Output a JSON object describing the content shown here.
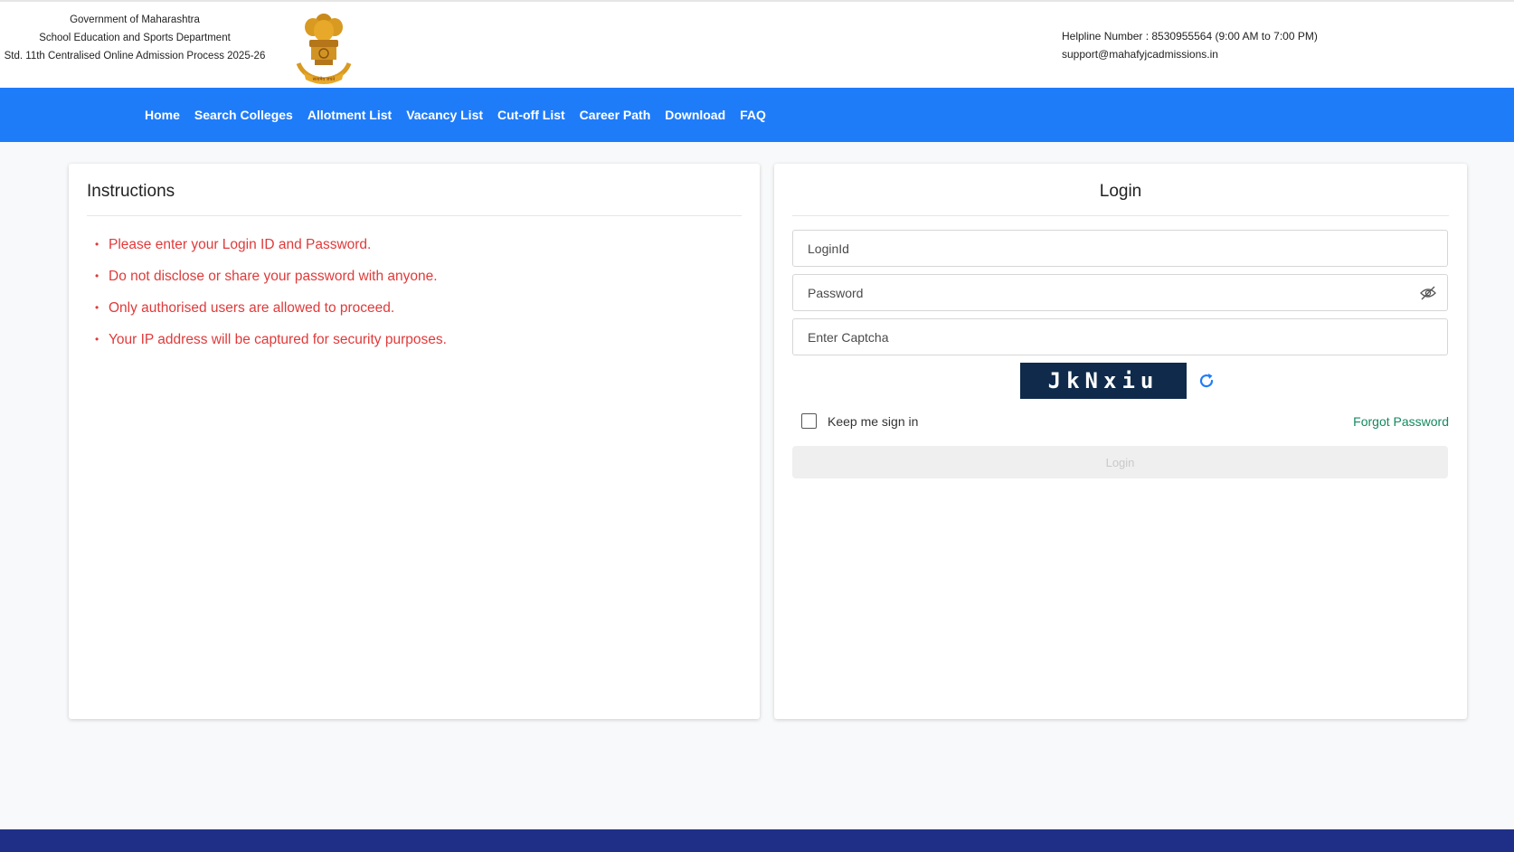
{
  "header": {
    "gov_line1": "Government of Maharashtra",
    "gov_line2": "School Education and Sports Department",
    "gov_line3": "Std. 11th Centralised Online Admission Process 2025-26",
    "emblem_motto": "सत्यमेव जयते",
    "helpline": "Helpline Number : 8530955564 (9:00 AM to 7:00 PM)",
    "email": "support@mahafyjcadmissions.in"
  },
  "nav": {
    "items": [
      "Home",
      "Search Colleges",
      "Allotment List",
      "Vacancy List",
      "Cut-off List",
      "Career Path",
      "Download",
      "FAQ"
    ]
  },
  "instructions": {
    "title": "Instructions",
    "items": [
      "Please enter your Login ID and Password.",
      "Do not disclose or share your password with anyone.",
      "Only authorised users are allowed to proceed.",
      "Your IP address will be captured for security purposes."
    ]
  },
  "login": {
    "title": "Login",
    "loginid_placeholder": "LoginId",
    "password_placeholder": "Password",
    "captcha_placeholder": "Enter Captcha",
    "captcha_text": "JkNxiu",
    "remember_label": "Keep me sign in",
    "forgot_label": "Forgot Password",
    "button_label": "Login"
  },
  "colors": {
    "nav_bg": "#1f7cf9",
    "instruction_text": "#e03a3a",
    "forgot_link": "#138a5f",
    "captcha_bg": "#0f2a4a",
    "footer_bg": "#1f2f88"
  }
}
